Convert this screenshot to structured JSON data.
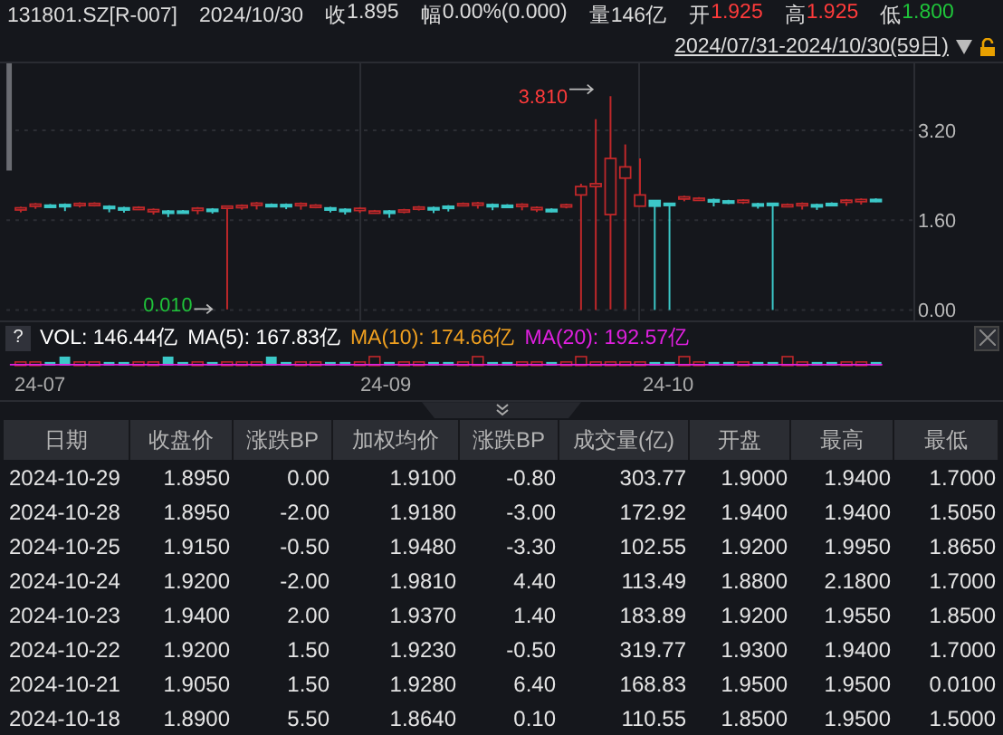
{
  "header": {
    "symbol": "131801.SZ[R-007]",
    "date": "2024/10/30",
    "quotes": [
      {
        "label": "收",
        "value": "1.895",
        "color": "#dcdcdc"
      },
      {
        "label": "幅",
        "value": "0.00%(0.000)",
        "color": "#dcdcdc"
      },
      {
        "label": "量",
        "value": "146亿",
        "color": "#dcdcdc"
      },
      {
        "label": "开",
        "value": "1.925",
        "color": "#ff3b3b"
      },
      {
        "label": "高",
        "value": "1.925",
        "color": "#ff3b3b"
      },
      {
        "label": "低",
        "value": "1.800",
        "color": "#1fc43a"
      }
    ]
  },
  "range": {
    "label": "2024/07/31-2024/10/30(59日)"
  },
  "price_chart": {
    "yaxis": [
      "3.20",
      "1.60",
      "0.00"
    ],
    "high_label": "3.810",
    "low_label": "0.010"
  },
  "volume": {
    "help": "?",
    "legend": [
      {
        "text": "VOL: 146.44亿",
        "color": "#ffffff"
      },
      {
        "text": "MA(5): 167.83亿",
        "color": "#ffffff"
      },
      {
        "text": "MA(10): 174.66亿",
        "color": "#f0a020"
      },
      {
        "text": "MA(20): 192.57亿",
        "color": "#e020e0"
      }
    ]
  },
  "xaxis": [
    "24-07",
    "24-09",
    "24-10"
  ],
  "table": {
    "columns": [
      "日期",
      "收盘价",
      "涨跌BP",
      "加权均价",
      "涨跌BP",
      "成交量(亿)",
      "开盘",
      "最高",
      "最低"
    ],
    "rows": [
      [
        "2024-10-29",
        "1.8950",
        "0.00",
        "1.9100",
        "-0.80",
        "303.77",
        "1.9000",
        "1.9400",
        "1.7000"
      ],
      [
        "2024-10-28",
        "1.8950",
        "-2.00",
        "1.9180",
        "-3.00",
        "172.92",
        "1.9400",
        "1.9400",
        "1.5050"
      ],
      [
        "2024-10-25",
        "1.9150",
        "-0.50",
        "1.9480",
        "-3.30",
        "102.55",
        "1.9200",
        "1.9950",
        "1.8650"
      ],
      [
        "2024-10-24",
        "1.9200",
        "-2.00",
        "1.9810",
        "4.40",
        "113.49",
        "1.8800",
        "2.1800",
        "1.7000"
      ],
      [
        "2024-10-23",
        "1.9400",
        "2.00",
        "1.9370",
        "1.40",
        "183.89",
        "1.9200",
        "1.9550",
        "1.8500"
      ],
      [
        "2024-10-22",
        "1.9200",
        "1.50",
        "1.9230",
        "-0.50",
        "319.77",
        "1.9300",
        "1.9400",
        "1.7000"
      ],
      [
        "2024-10-21",
        "1.9050",
        "1.50",
        "1.9280",
        "6.40",
        "168.83",
        "1.9500",
        "1.9500",
        "0.0100"
      ],
      [
        "2024-10-18",
        "1.8900",
        "5.50",
        "1.8640",
        "0.10",
        "110.55",
        "1.8500",
        "1.9500",
        "1.5000"
      ]
    ]
  }
}
